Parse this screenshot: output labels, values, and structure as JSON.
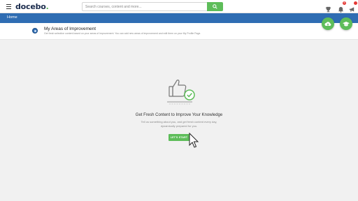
{
  "header": {
    "logo_text": "docebo",
    "logo_dot": ".",
    "search_placeholder": "Search courses, content and more...",
    "icons": [
      "menu-icon",
      "search-icon",
      "trophy-icon",
      "bell-icon",
      "megaphone-icon"
    ],
    "bell_badge": "5"
  },
  "nav": {
    "home_label": "Home"
  },
  "area": {
    "title": "My Areas of Improvement",
    "description": "Get fresh selective content based on your areas of improvement. You can add new areas of improvement and edit them on your My Profile Page."
  },
  "empty_state": {
    "title": "Get Fresh Content to Improve Your Knowledge",
    "description_line1": "Tell us something about you, and get fresh content every day,",
    "description_line2": "dynamically prepared for you.",
    "button_label": "LET'S START"
  },
  "colors": {
    "brand_green": "#5ebd5a",
    "nav_blue": "#2f6db3",
    "logo_navy": "#1a2b4c",
    "badge_red": "#e53935"
  }
}
